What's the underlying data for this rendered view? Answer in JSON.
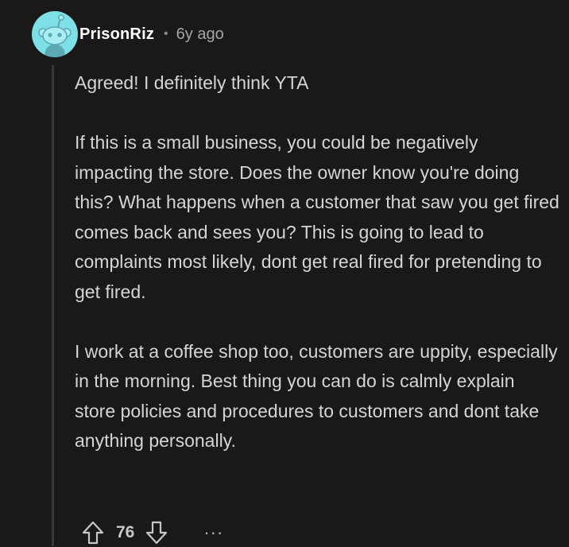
{
  "comment": {
    "username": "PrisonRiz",
    "separator": "•",
    "age": "6y ago",
    "paragraphs": [
      "Agreed! I definitely think YTA",
      "If this is a small business, you could be negatively impacting the store. Does the owner know you're doing this? What happens when a customer that saw you get fired comes back and sees you? This is going to lead to complaints most likely, dont get real fired for pretending to get fired.",
      "I work at a coffee shop too, customers are uppity, especially in the morning. Best thing you can do is calmly explain store policies and procedures to customers and dont take anything personally."
    ],
    "score": "76",
    "more_label": "···"
  },
  "icons": {
    "avatar": "snoo-avatar-icon",
    "upvote": "upvote-arrow-icon",
    "downvote": "downvote-arrow-icon",
    "more": "more-options-icon"
  },
  "colors": {
    "background": "#1a1818",
    "avatar_bg": "#7ee0e6",
    "text": "#d7d4d3",
    "username": "#ffffff"
  }
}
